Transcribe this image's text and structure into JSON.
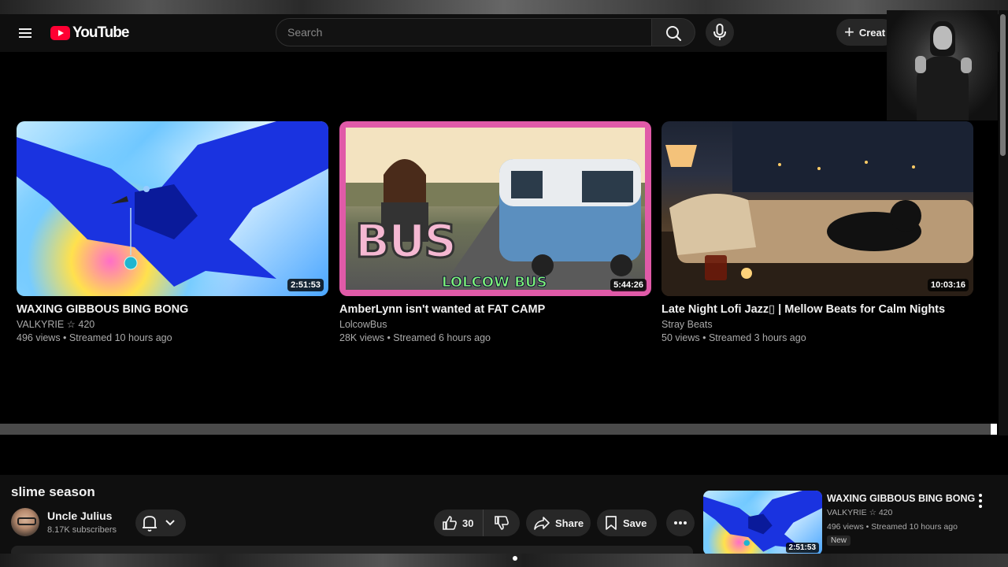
{
  "header": {
    "logo_text": "YouTube",
    "search_placeholder": "Search",
    "create_label": "Creat"
  },
  "videos": [
    {
      "title": "WAXING GIBBOUS BING BONG",
      "channel": "VALKYRIE ☆ 420",
      "meta": "496 views • Streamed 10 hours ago",
      "duration": "2:51:53"
    },
    {
      "title": "AmberLynn isn't wanted at FAT CAMP",
      "channel": "LolcowBus",
      "meta": "28K views • Streamed 6 hours ago",
      "duration": "5:44:26",
      "thumb_text": "BUS",
      "thumb_brand": "LOLCOW BUS"
    },
    {
      "title": "Late Night Lofi Jazz▯ | Mellow Beats for Calm Nights",
      "channel": "Stray Beats",
      "meta": "50 views • Streamed 3 hours ago",
      "duration": "10:03:16"
    }
  ],
  "watch": {
    "title": "slime season",
    "channel_name": "Uncle Julius",
    "subscribers": "8.17K subscribers",
    "like_count": "30",
    "share_label": "Share",
    "save_label": "Save"
  },
  "recommended": {
    "title": "WAXING GIBBOUS BING BONG",
    "channel": "VALKYRIE ☆ 420",
    "meta": "496 views • Streamed 10 hours ago",
    "badge": "New",
    "duration": "2:51:53"
  },
  "colors": {
    "background": "#000000",
    "logo_red": "#ff0033",
    "pill_bg": "#272727"
  }
}
